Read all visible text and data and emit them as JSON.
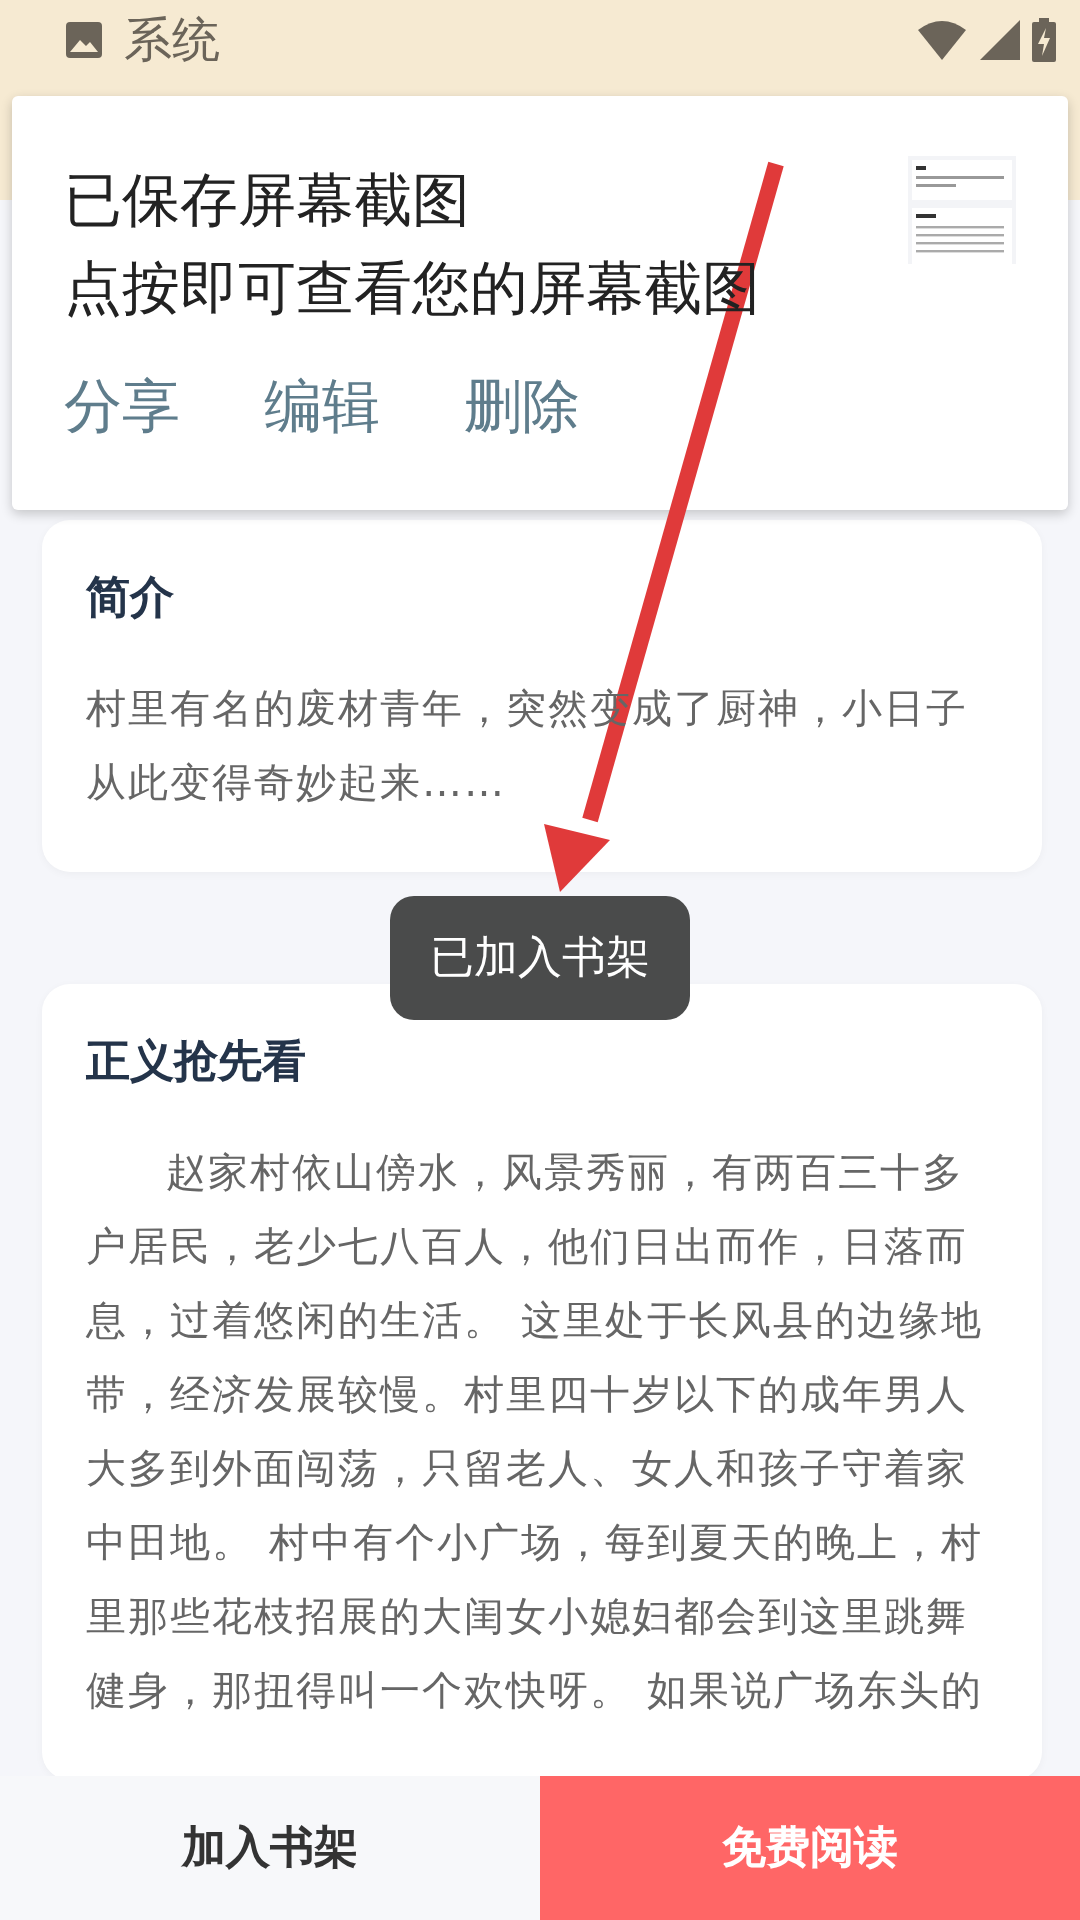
{
  "status_bar": {
    "app_label": "系统"
  },
  "notification": {
    "title": "已保存屏幕截图",
    "message": "点按即可查看您的屏幕截图",
    "actions": [
      "分享",
      "编辑",
      "删除"
    ]
  },
  "sections": [
    {
      "title": "简介",
      "body": "村里有名的废材青年，突然变成了厨神，小日子从此变得奇妙起来……",
      "indent": false
    },
    {
      "title": "正义抢先看",
      "body": "赵家村依山傍水，风景秀丽，有两百三十多户居民，老少七八百人，他们日出而作，日落而息，过着悠闲的生活。 这里处于长风县的边缘地带，经济发展较慢。村里四十岁以下的成年男人大多到外面闯荡，只留老人、女人和孩子守着家中田地。 村中有个小广场，每到夏天的晚上，村里那些花枝招展的大闺女小媳妇都会到这里跳舞健身，那扭得叫一个欢快呀。 如果说广场东头的",
      "indent": true
    }
  ],
  "toast": "已加入书架",
  "bottom_bar": {
    "buttons": [
      {
        "label": "加入书架",
        "kind": "secondary"
      },
      {
        "label": "免费阅读",
        "kind": "primary"
      }
    ]
  }
}
